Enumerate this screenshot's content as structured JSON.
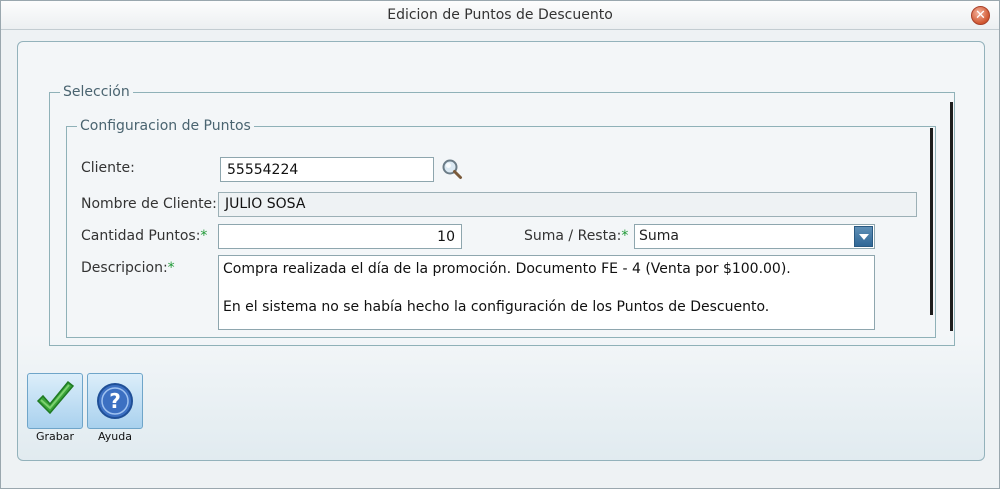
{
  "window": {
    "title": "Edicion de Puntos de Descuento",
    "close_icon": "close-icon"
  },
  "selection_group": {
    "legend": "Selección"
  },
  "config_group": {
    "legend": "Configuracion de Puntos"
  },
  "form": {
    "cliente": {
      "label": "Cliente:",
      "value": "55554224",
      "search_icon": "magnifier-icon"
    },
    "nombre": {
      "label": "Nombre de Cliente:",
      "value": "JULIO SOSA"
    },
    "cantidad": {
      "label": "Cantidad Puntos:",
      "required_mark": "*",
      "value": "10"
    },
    "suma_resta": {
      "label": "Suma / Resta:",
      "required_mark": "*",
      "value": "Suma"
    },
    "descripcion": {
      "label": "Descripcion:",
      "required_mark": "*",
      "line1": "Compra realizada el día de la promoción. Documento FE - 4 (Venta por $100.00).",
      "line2": "En el sistema no se había hecho la configuración de los Puntos de Descuento."
    }
  },
  "toolbar": {
    "grabar_label": "Grabar",
    "ayuda_label": "Ayuda"
  },
  "colors": {
    "accent_green": "#1f9a36",
    "panel_border": "#93b2bb",
    "close_red": "#d0562f"
  }
}
